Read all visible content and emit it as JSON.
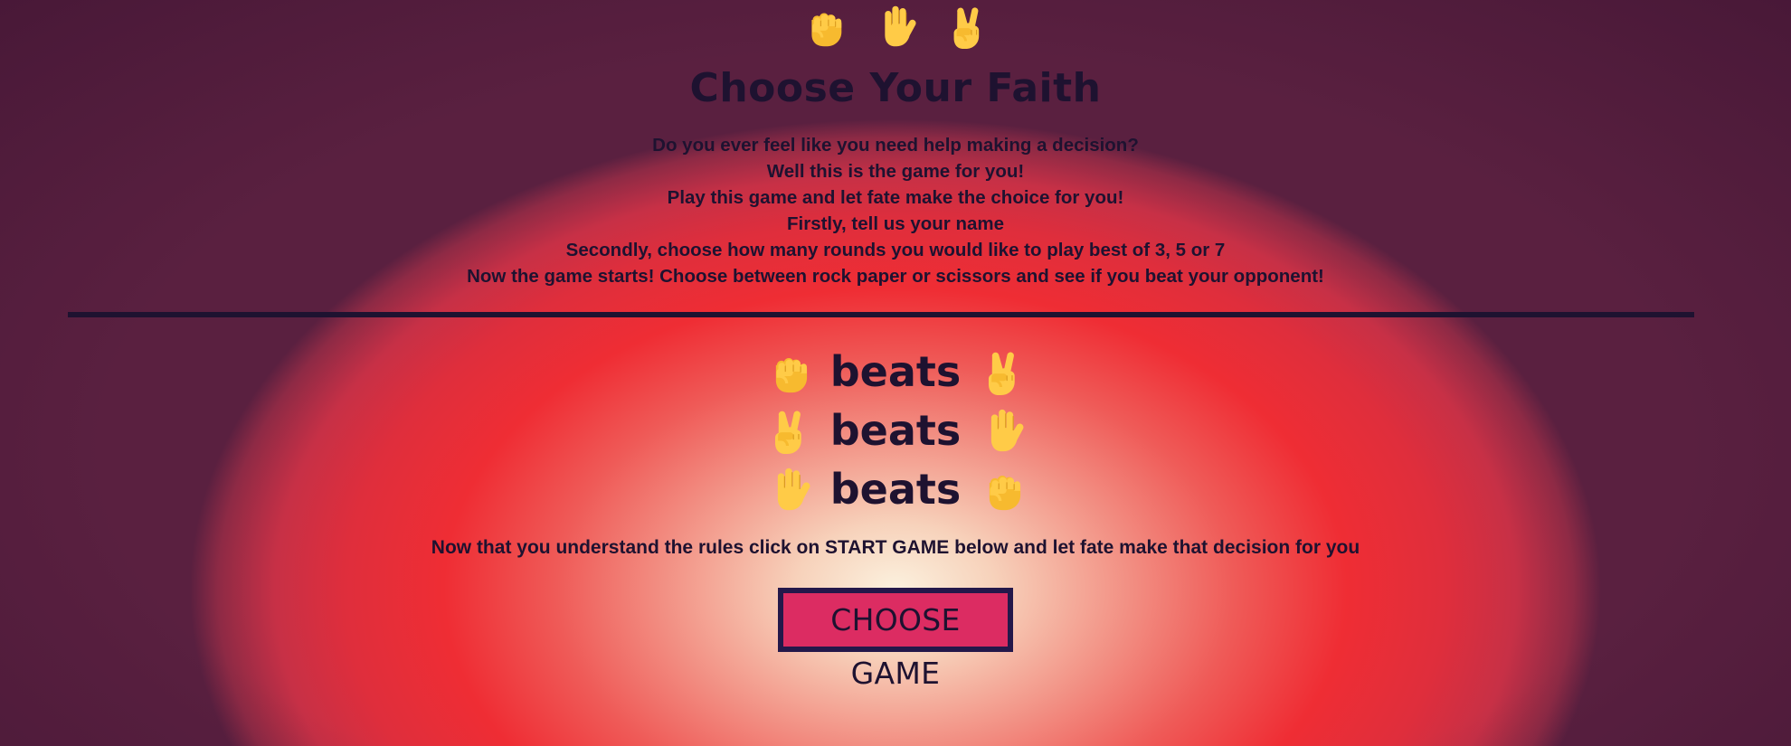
{
  "header": {
    "icons": [
      "rock-fist-icon",
      "paper-hand-icon",
      "scissors-victory-icon"
    ],
    "title": "Choose Your Faith"
  },
  "intro": {
    "lines": [
      "Do you ever feel like you need help making a decision?",
      "Well this is the game for you!",
      "Play this game and let fate make the choice for you!",
      "Firstly, tell us your name",
      "Secondly, choose how many rounds you would like to play best of 3, 5 or 7",
      "Now the game starts! Choose between rock paper or scissors and see if you beat your opponent!"
    ]
  },
  "rules": [
    {
      "winner": "rock",
      "word": "beats",
      "loser": "scissors"
    },
    {
      "winner": "scissors",
      "word": "beats",
      "loser": "paper"
    },
    {
      "winner": "paper",
      "word": "beats",
      "loser": "rock"
    }
  ],
  "instruction": "Now that you understand the rules click on START GAME below and let fate make that decision for you",
  "button": {
    "label": "CHOOSE GAME"
  },
  "colors": {
    "text": "#1e1230",
    "emoji": "#ffcb47",
    "button_bg": "#dc2c62",
    "button_border": "#24184a",
    "background_red": "#ef2d34",
    "background_glow": "#fbf1de"
  }
}
